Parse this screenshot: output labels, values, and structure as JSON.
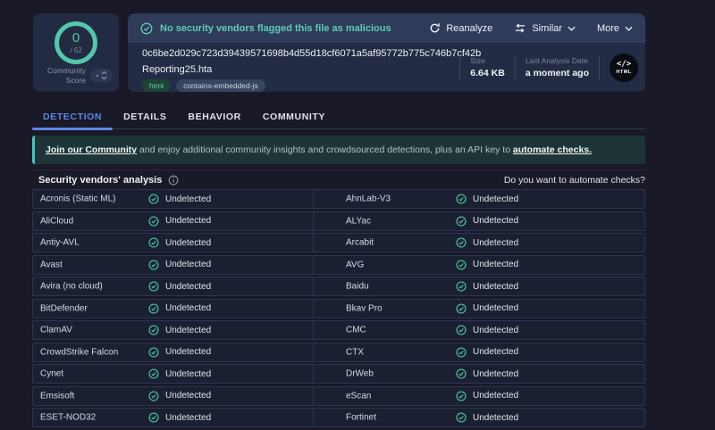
{
  "score_widget": {
    "detections": "0",
    "total": "/ 62",
    "label": "Community Score"
  },
  "file_card": {
    "status_message": "No security vendors flagged this file as malicious",
    "actions": {
      "reanalyze": "Reanalyze",
      "similar": "Similar",
      "more": "More"
    },
    "hash": "0c6be2d029c723d39439571698b4d55d18cf6071a5af95772b775c746b7cf42b",
    "filename": "Reporting25.hta",
    "tags": [
      "html",
      "contains-embedded-js"
    ],
    "size": {
      "label": "Size",
      "value": "6.64 KB"
    },
    "last_analysis": {
      "label": "Last Analysis Date",
      "value": "a moment ago"
    },
    "filetype": {
      "glyph": "</>",
      "label": "HTML"
    }
  },
  "tabs": [
    {
      "label": "DETECTION",
      "active": true
    },
    {
      "label": "DETAILS",
      "active": false
    },
    {
      "label": "BEHAVIOR",
      "active": false
    },
    {
      "label": "COMMUNITY",
      "active": false
    }
  ],
  "community_banner": {
    "link_join": "Join our Community",
    "body": " and enjoy additional community insights and crowdsourced detections, plus an API key to ",
    "link_automate": "automate checks."
  },
  "analysis": {
    "title": "Security vendors' analysis",
    "automate_prompt": "Do you want to automate checks?",
    "status_undetected": "Undetected",
    "rows": [
      {
        "left": "Acronis (Static ML)",
        "right": "AhnLab-V3"
      },
      {
        "left": "AliCloud",
        "right": "ALYac"
      },
      {
        "left": "Antiy-AVL",
        "right": "Arcabit"
      },
      {
        "left": "Avast",
        "right": "AVG"
      },
      {
        "left": "Avira (no cloud)",
        "right": "Baidu"
      },
      {
        "left": "BitDefender",
        "right": "Bkav Pro"
      },
      {
        "left": "ClamAV",
        "right": "CMC"
      },
      {
        "left": "CrowdStrike Falcon",
        "right": "CTX"
      },
      {
        "left": "Cynet",
        "right": "DrWeb"
      },
      {
        "left": "Emsisoft",
        "right": "eScan"
      },
      {
        "left": "ESET-NOD32",
        "right": "Fortinet"
      }
    ]
  },
  "colors": {
    "page_bg": "#191927",
    "card_bg": "#232c44",
    "header_strip_bg": "#2f3c59",
    "accent_teal": "#52c7a9",
    "status_teal": "#61cbb2",
    "tab_active_blue": "#5d87e8",
    "community_banner_bg": "#1d3537",
    "community_banner_border": "#41c7c2",
    "tag_html_text": "#63d2a2",
    "row_bg": "#1a2032",
    "row_border": "#2d3554",
    "check_icon": "#4cc2a2"
  },
  "icons": {
    "status_check": "check-circle-icon",
    "reanalyze": "refresh-icon",
    "similar": "similar-arrows-icon",
    "chevron": "chevron-down-icon",
    "info": "info-circle-icon",
    "vote": "vote-carets-icon",
    "filetype": "code-brackets-icon"
  }
}
